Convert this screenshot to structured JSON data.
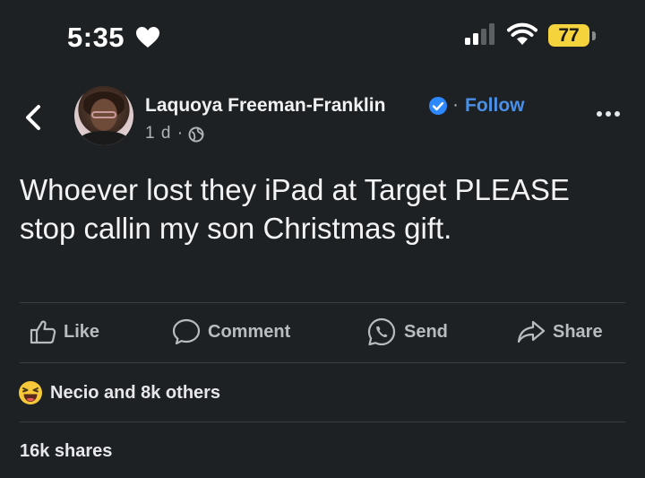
{
  "status_bar": {
    "time": "5:35",
    "battery": "77"
  },
  "post": {
    "author": "Laquoya Freeman-Franklin",
    "follow_label": "Follow",
    "separator": "·",
    "time_ago": "1 d ·",
    "text": "Whoever lost they iPad at Target PLEASE stop callin my son Christmas gift."
  },
  "actions": {
    "like": "Like",
    "comment": "Comment",
    "send": "Send",
    "share": "Share"
  },
  "reactions": {
    "summary": "Necio and 8k others"
  },
  "shares": {
    "label": "16k shares"
  },
  "colors": {
    "background": "#1e2123",
    "accent": "#4a90e8",
    "battery": "#f5d33c",
    "reaction_emoji": "#f7c83a"
  }
}
